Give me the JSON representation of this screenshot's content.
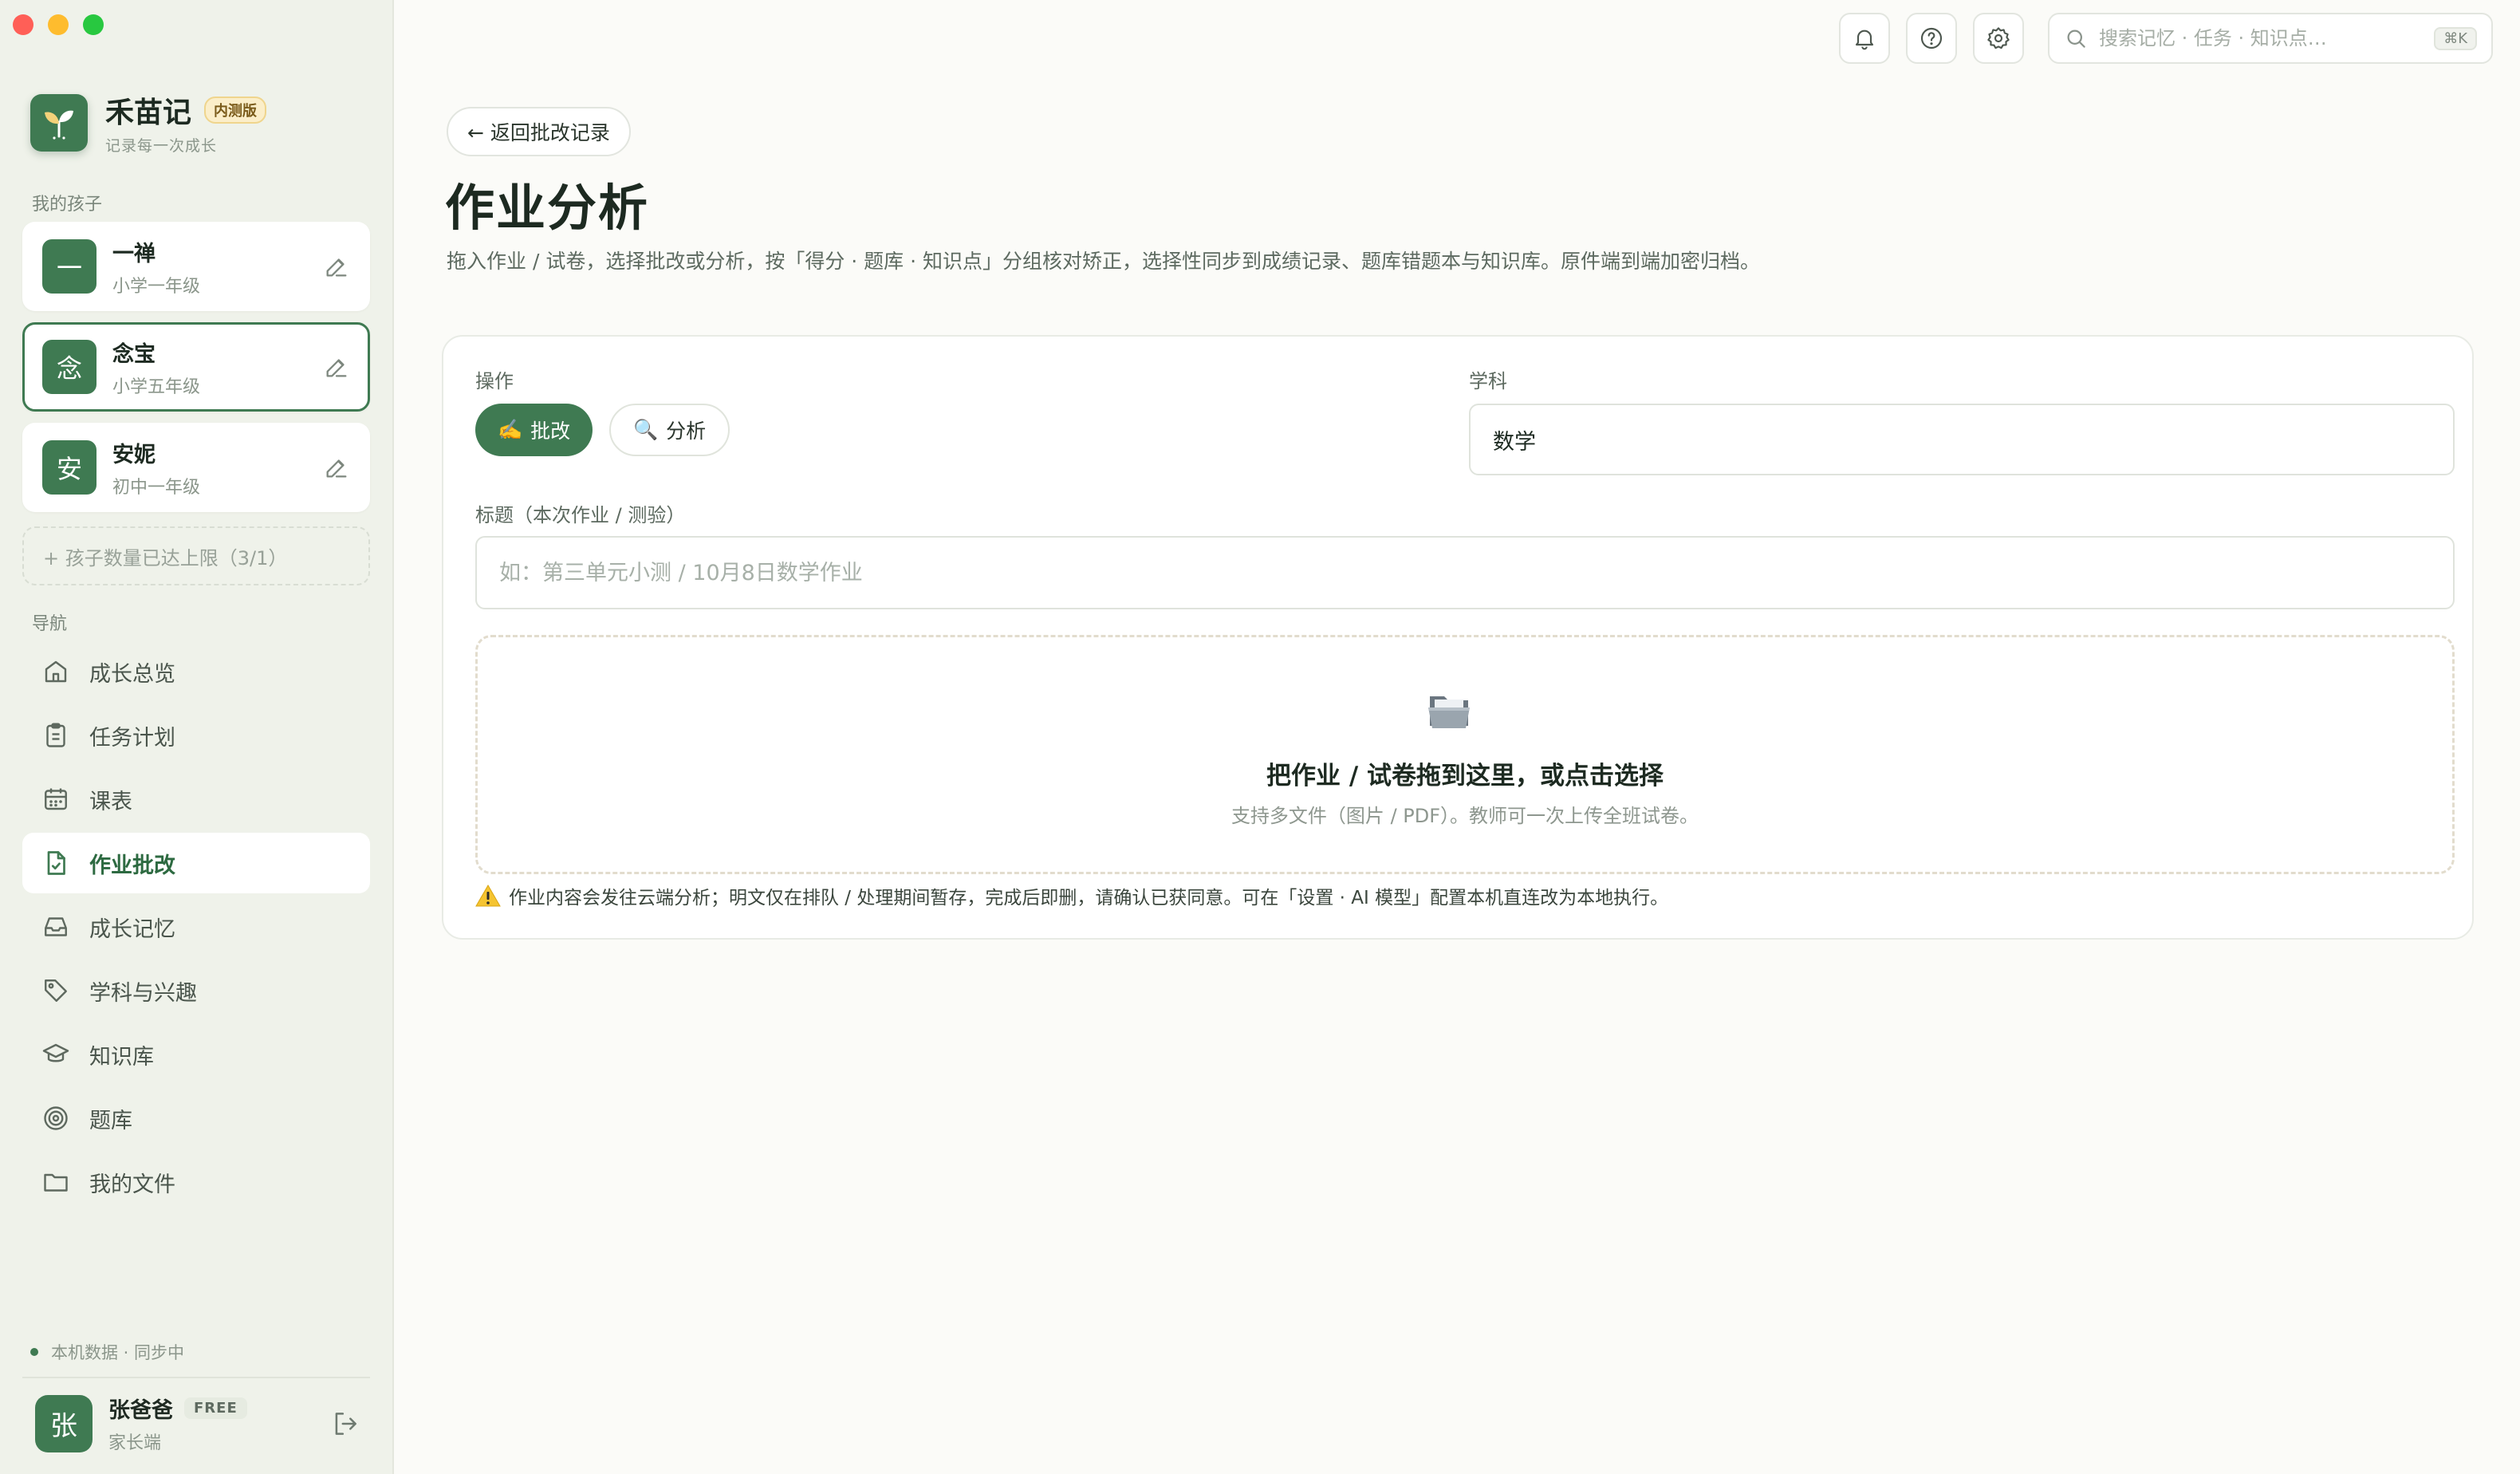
{
  "brand": {
    "name": "禾苗记",
    "badge": "内测版",
    "tagline": "记录每一次成长"
  },
  "sidebar": {
    "children_label": "我的孩子",
    "children": [
      {
        "avatar": "一",
        "name": "一禅",
        "grade": "小学一年级"
      },
      {
        "avatar": "念",
        "name": "念宝",
        "grade": "小学五年级"
      },
      {
        "avatar": "安",
        "name": "安妮",
        "grade": "初中一年级"
      }
    ],
    "child_limit": "+ 孩子数量已达上限（3/1）",
    "nav_label": "导航",
    "nav": [
      {
        "label": "成长总览",
        "icon": "home-icon"
      },
      {
        "label": "任务计划",
        "icon": "clipboard-icon"
      },
      {
        "label": "课表",
        "icon": "calendar-icon"
      },
      {
        "label": "作业批改",
        "icon": "file-check-icon",
        "active": true
      },
      {
        "label": "成长记忆",
        "icon": "inbox-icon"
      },
      {
        "label": "学科与兴趣",
        "icon": "tag-icon"
      },
      {
        "label": "知识库",
        "icon": "graduation-cap-icon"
      },
      {
        "label": "题库",
        "icon": "target-icon"
      },
      {
        "label": "我的文件",
        "icon": "folder-icon"
      }
    ],
    "sync_status": "本机数据 · 同步中",
    "user": {
      "avatar": "张",
      "name": "张爸爸",
      "plan": "FREE",
      "role": "家长端"
    }
  },
  "topbar": {
    "search_placeholder": "搜索记忆 · 任务 · 知识点…",
    "shortcut": "⌘K"
  },
  "main": {
    "back_label": "← 返回批改记录",
    "title": "作业分析",
    "description": "拖入作业 / 试卷，选择批改或分析，按「得分 · 题库 · 知识点」分组核对矫正，选择性同步到成绩记录、题库错题本与知识库。原件端到端加密归档。",
    "operation_label": "操作",
    "operations": [
      {
        "emoji": "✍️",
        "label": "批改",
        "active": true
      },
      {
        "emoji": "🔍",
        "label": "分析",
        "active": false
      }
    ],
    "subject_label": "学科",
    "subject_value": "数学",
    "title_field_label": "标题（本次作业 / 测验）",
    "title_placeholder": "如：第三单元小测 / 10月8日数学作业",
    "dropzone_title": "把作业 / 试卷拖到这里，或点击选择",
    "dropzone_sub": "支持多文件（图片 / PDF）。教师可一次上传全班试卷。",
    "warning": "作业内容会发往云端分析；明文仅在排队 / 处理期间暂存，完成后即删，请确认已获同意。可在「设置 · AI 模型」配置本机直连改为本地执行。"
  },
  "colors": {
    "accent": "#3f7a52",
    "sidebar_bg": "#eff2ea",
    "badge_bg": "#fbeec9"
  }
}
